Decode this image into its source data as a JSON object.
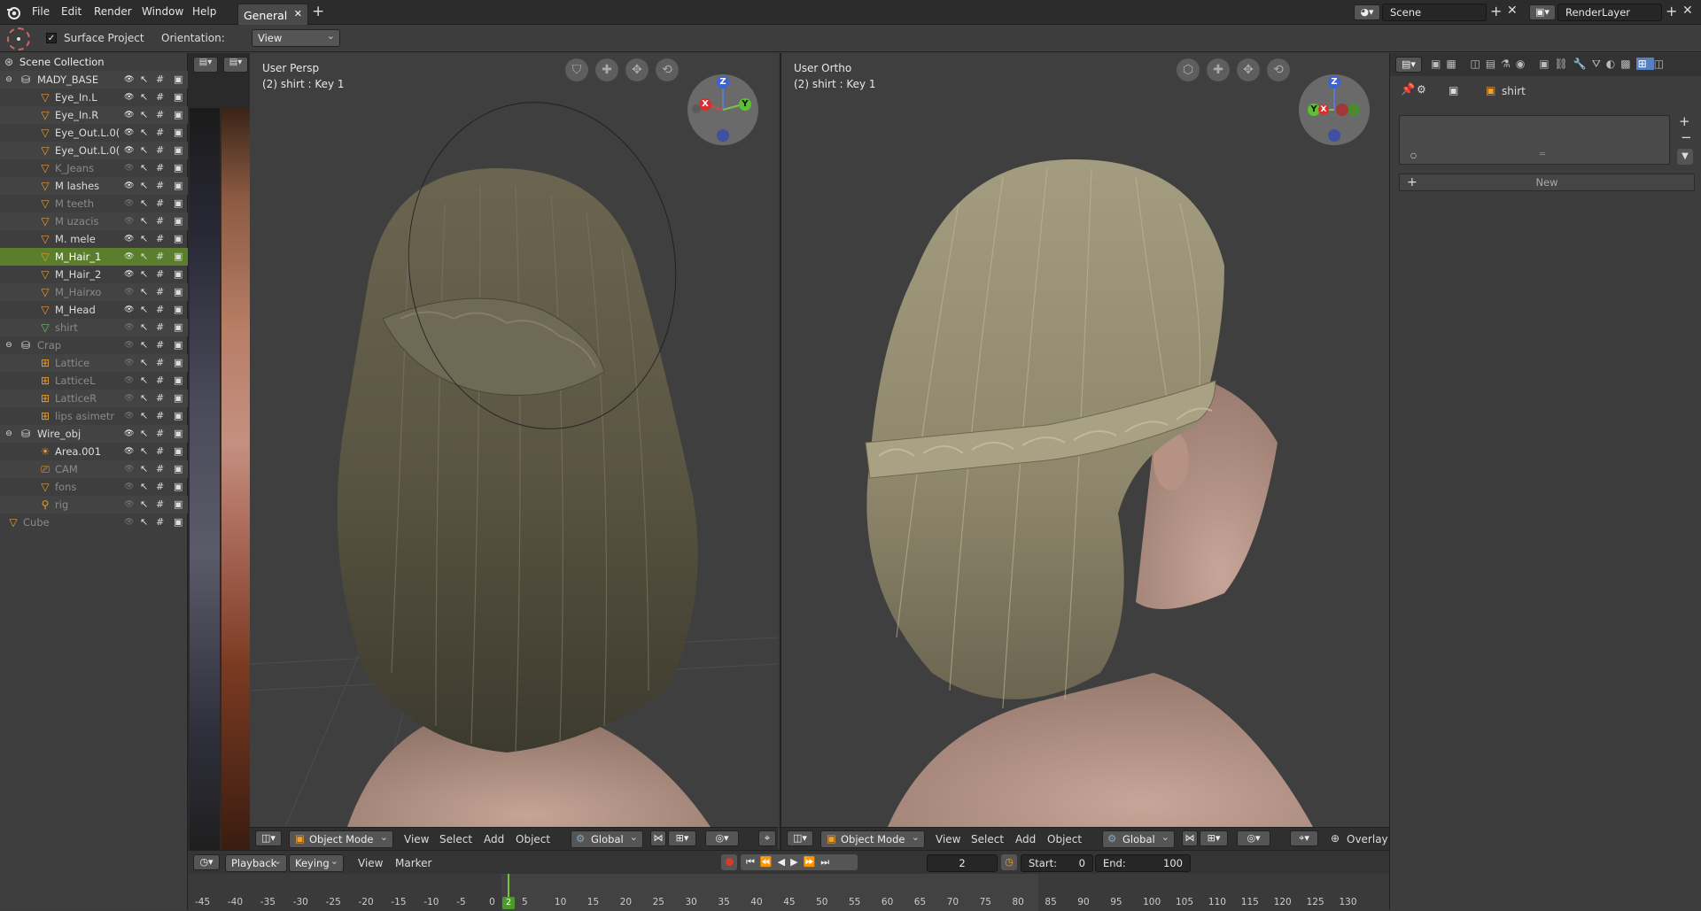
{
  "menu": {
    "items": [
      "File",
      "Edit",
      "Render",
      "Window",
      "Help"
    ]
  },
  "workspace_tab": {
    "label": "General"
  },
  "scene": {
    "name": "Scene"
  },
  "render_layer": {
    "name": "RenderLayer"
  },
  "toolbar": {
    "surface_project_label": "Surface Project",
    "orientation_label": "Orientation:",
    "orientation_value": "View"
  },
  "outliner": {
    "root": "Scene Collection",
    "rows": [
      {
        "label": "MADY_BASE",
        "type": "collection",
        "level": 0,
        "dim": false,
        "selected": false
      },
      {
        "label": "Eye_In.L",
        "type": "mesh",
        "level": 1,
        "dim": false,
        "selected": false
      },
      {
        "label": "Eye_In.R",
        "type": "mesh",
        "level": 1,
        "dim": false,
        "selected": false
      },
      {
        "label": "Eye_Out.L.0(",
        "type": "mesh",
        "level": 1,
        "dim": false,
        "selected": false
      },
      {
        "label": "Eye_Out.L.0(",
        "type": "mesh",
        "level": 1,
        "dim": false,
        "selected": false
      },
      {
        "label": "K_Jeans",
        "type": "mesh",
        "level": 1,
        "dim": true,
        "selected": false
      },
      {
        "label": "M lashes",
        "type": "mesh",
        "level": 1,
        "dim": false,
        "selected": false
      },
      {
        "label": "M teeth",
        "type": "mesh",
        "level": 1,
        "dim": true,
        "selected": false
      },
      {
        "label": "M uzacis",
        "type": "mesh",
        "level": 1,
        "dim": true,
        "selected": false
      },
      {
        "label": "M. mele",
        "type": "mesh",
        "level": 1,
        "dim": false,
        "selected": false
      },
      {
        "label": "M_Hair_1",
        "type": "mesh",
        "level": 1,
        "dim": false,
        "selected": true
      },
      {
        "label": "M_Hair_2",
        "type": "mesh",
        "level": 1,
        "dim": false,
        "selected": false
      },
      {
        "label": "M_Hairxo",
        "type": "mesh",
        "level": 1,
        "dim": true,
        "selected": false
      },
      {
        "label": "M_Head",
        "type": "mesh",
        "level": 1,
        "dim": false,
        "selected": false
      },
      {
        "label": "shirt",
        "type": "mesh",
        "level": 1,
        "dim": true,
        "selected": false
      },
      {
        "label": "Crap",
        "type": "collection",
        "level": 0,
        "dim": true,
        "selected": false
      },
      {
        "label": "Lattice",
        "type": "lattice",
        "level": 1,
        "dim": true,
        "selected": false
      },
      {
        "label": "LatticeL",
        "type": "lattice",
        "level": 1,
        "dim": true,
        "selected": false
      },
      {
        "label": "LatticeR",
        "type": "lattice",
        "level": 1,
        "dim": true,
        "selected": false
      },
      {
        "label": "lips asimetr",
        "type": "lattice",
        "level": 1,
        "dim": true,
        "selected": false
      },
      {
        "label": "Wire_obj",
        "type": "collection",
        "level": 0,
        "dim": false,
        "selected": false
      },
      {
        "label": "Area.001",
        "type": "light",
        "level": 1,
        "dim": false,
        "selected": false
      },
      {
        "label": "CAM",
        "type": "camera",
        "level": 1,
        "dim": true,
        "selected": false
      },
      {
        "label": "fons",
        "type": "mesh",
        "level": 1,
        "dim": true,
        "selected": false
      },
      {
        "label": "rig",
        "type": "armature",
        "level": 1,
        "dim": true,
        "selected": false
      },
      {
        "label": "Cube",
        "type": "mesh",
        "level": 0,
        "dim": true,
        "selected": false
      }
    ]
  },
  "viewport_left": {
    "name": "User Persp",
    "object": "(2) shirt : Key 1",
    "mode": "Object Mode",
    "menus": [
      "View",
      "Select",
      "Add",
      "Object"
    ],
    "orientation": "Global"
  },
  "viewport_right": {
    "name": "User Ortho",
    "object": "(2) shirt : Key 1",
    "mode": "Object Mode",
    "menus": [
      "View",
      "Select",
      "Add",
      "Object"
    ],
    "orientation": "Global",
    "overlay": "Overlay"
  },
  "gizmo": {
    "z": "Z",
    "y": "Y",
    "x": "X"
  },
  "properties": {
    "object_name": "shirt",
    "new_label": "New"
  },
  "timeline": {
    "menus": [
      "Playback",
      "Keying",
      "View",
      "Marker"
    ],
    "current_frame": "2",
    "start_label": "Start:",
    "start_value": "0",
    "end_label": "End:",
    "end_value": "100",
    "ticks": [
      "-45",
      "-40",
      "-35",
      "-30",
      "-25",
      "-20",
      "-15",
      "-10",
      "-5",
      "0",
      "5",
      "10",
      "15",
      "20",
      "25",
      "30",
      "35",
      "40",
      "45",
      "50",
      "55",
      "60",
      "65",
      "70",
      "75",
      "80",
      "85",
      "90",
      "95",
      "100",
      "105",
      "110",
      "115",
      "120",
      "125",
      "130"
    ],
    "playhead": "2"
  },
  "colors": {
    "selection": "#5a7e2c",
    "accent": "#79c63a",
    "hair_dark": "#5a5542",
    "hair_light": "#9d9678",
    "skin": "#b89a8c"
  }
}
